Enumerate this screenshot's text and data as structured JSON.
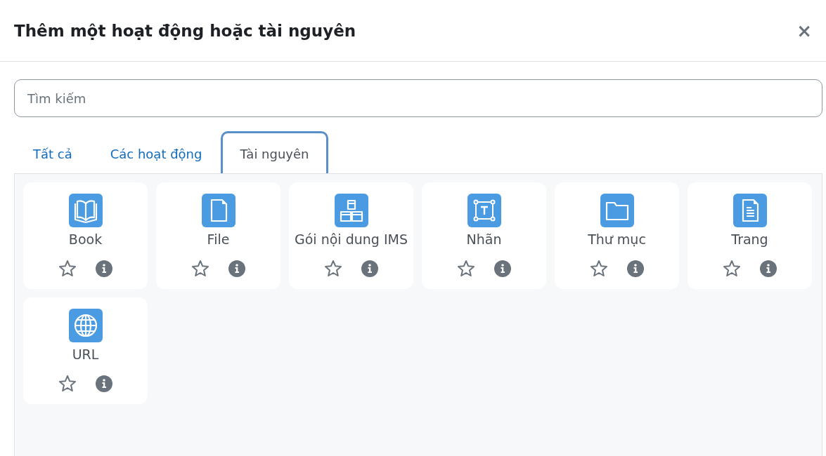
{
  "dialog": {
    "title": "Thêm một hoạt động hoặc tài nguyên",
    "close": "×"
  },
  "search": {
    "placeholder": "Tìm kiếm"
  },
  "tabs": [
    {
      "label": "Tất cả",
      "selected": false
    },
    {
      "label": "Các hoạt động",
      "selected": false
    },
    {
      "label": "Tài nguyên",
      "selected": true
    }
  ],
  "items": [
    {
      "kind": "book",
      "name": "Book",
      "starred": false
    },
    {
      "kind": "file",
      "name": "File",
      "starred": false
    },
    {
      "kind": "package",
      "name": "Gói nội dung IMS",
      "starred": false
    },
    {
      "kind": "label",
      "name": "Nhãn",
      "starred": false
    },
    {
      "kind": "folder",
      "name": "Thư mục",
      "starred": false
    },
    {
      "kind": "page",
      "name": "Trang",
      "starred": false
    },
    {
      "kind": "url",
      "name": "URL",
      "starred": false
    }
  ]
}
